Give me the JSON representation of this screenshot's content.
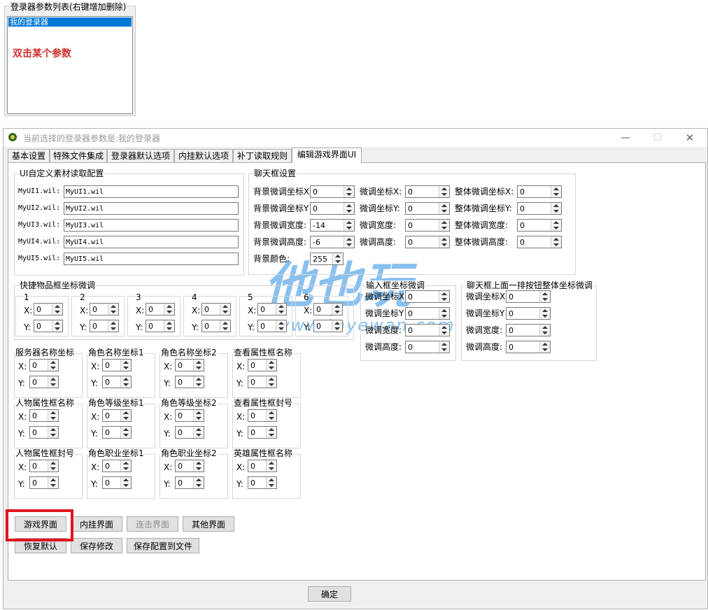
{
  "list_panel": {
    "title": "登录器参数列表(右键增加删除)",
    "selected_item": "我的登录器",
    "hint": "双击某个参数"
  },
  "window": {
    "title": "当前选择的登录器参数是:我的登录器",
    "minimize": "—",
    "maximize": "☐",
    "close": "✕"
  },
  "tabs": [
    "基本设置",
    "特殊文件集成",
    "登录器默认选项",
    "内挂默认选项",
    "补丁读取规则",
    "编辑游戏界面UI"
  ],
  "ui_config": {
    "title": "UI自定义素材读取配置",
    "rows": [
      {
        "label": "MyUI1.wil:",
        "value": "MyUI1.wil"
      },
      {
        "label": "MyUI2.wil:",
        "value": "MyUI2.wil"
      },
      {
        "label": "MyUI3.wil:",
        "value": "MyUI3.wil"
      },
      {
        "label": "MyUI4.wil:",
        "value": "MyUI4.wil"
      },
      {
        "label": "MyUI5.wil:",
        "value": "MyUI5.wil"
      }
    ]
  },
  "chat": {
    "title": "聊天框设置",
    "col1": [
      {
        "label": "背景微调坐标X",
        "value": "0"
      },
      {
        "label": "背景微调坐标Y",
        "value": "0"
      },
      {
        "label": "背景微调宽度:",
        "value": "-14"
      },
      {
        "label": "背景微调高度:",
        "value": "-6"
      },
      {
        "label": "背景颜色:",
        "value": "255"
      }
    ],
    "col2": [
      {
        "label": "微调坐标X:",
        "value": "0"
      },
      {
        "label": "微调坐标Y:",
        "value": "0"
      },
      {
        "label": "微调宽度:",
        "value": "0"
      },
      {
        "label": "微调高度:",
        "value": "0"
      }
    ],
    "col3": [
      {
        "label": "整体微调坐标X:",
        "value": "0"
      },
      {
        "label": "整体微调坐标Y:",
        "value": "0"
      },
      {
        "label": "整体微调宽度:",
        "value": "0"
      },
      {
        "label": "整体微调高度:",
        "value": "0"
      }
    ]
  },
  "quick_items": {
    "title": "快捷物品框坐标微调",
    "slots": [
      {
        "n": "1",
        "x": "0",
        "y": "0"
      },
      {
        "n": "2",
        "x": "0",
        "y": "0"
      },
      {
        "n": "3",
        "x": "0",
        "y": "0"
      },
      {
        "n": "4",
        "x": "0",
        "y": "0"
      },
      {
        "n": "5",
        "x": "0",
        "y": "0"
      },
      {
        "n": "6",
        "x": "0",
        "y": "0"
      }
    ],
    "x_label": "X:",
    "y_label": "Y:"
  },
  "input_box": {
    "title": "输入框坐标微调",
    "rows": [
      {
        "label": "微调坐标X",
        "value": "0"
      },
      {
        "label": "微调坐标Y",
        "value": "0"
      },
      {
        "label": "微调宽度:",
        "value": "0"
      },
      {
        "label": "微调高度:",
        "value": "0"
      }
    ]
  },
  "chat_buttons": {
    "title": "聊天框上面一排按钮整体坐标微调",
    "rows": [
      {
        "label": "微调坐标X",
        "value": "0"
      },
      {
        "label": "微调坐标Y",
        "value": "0"
      },
      {
        "label": "微调宽度:",
        "value": "0"
      },
      {
        "label": "微调高度:",
        "value": "0"
      }
    ]
  },
  "coord_groups": [
    {
      "title": "服务器名称坐标",
      "x": "0",
      "y": "0"
    },
    {
      "title": "角色名称坐标1",
      "x": "0",
      "y": "0"
    },
    {
      "title": "角色名称坐标2",
      "x": "0",
      "y": "0"
    },
    {
      "title": "查看属性框名称",
      "x": "0",
      "y": "0"
    },
    {
      "title": "人物属性框名称",
      "x": "0",
      "y": "0"
    },
    {
      "title": "角色等级坐标1",
      "x": "0",
      "y": "0"
    },
    {
      "title": "角色等级坐标2",
      "x": "0",
      "y": "0"
    },
    {
      "title": "查看属性框封号",
      "x": "0",
      "y": "0"
    },
    {
      "title": "人物属性框封号",
      "x": "0",
      "y": "0"
    },
    {
      "title": "角色职业坐标1",
      "x": "0",
      "y": "0"
    },
    {
      "title": "角色职业坐标2",
      "x": "0",
      "y": "0"
    },
    {
      "title": "英雄属性框名称",
      "x": "0",
      "y": "0"
    }
  ],
  "buttons_row1": [
    "游戏界面",
    "内挂界面",
    "连击界面",
    "其他界面"
  ],
  "buttons_row2": [
    "恢复默认",
    "保存修改",
    "保存配置到文件"
  ],
  "ok_button": "确定",
  "watermark": {
    "big": "他也玩",
    "url": "www.tayewan.com"
  }
}
